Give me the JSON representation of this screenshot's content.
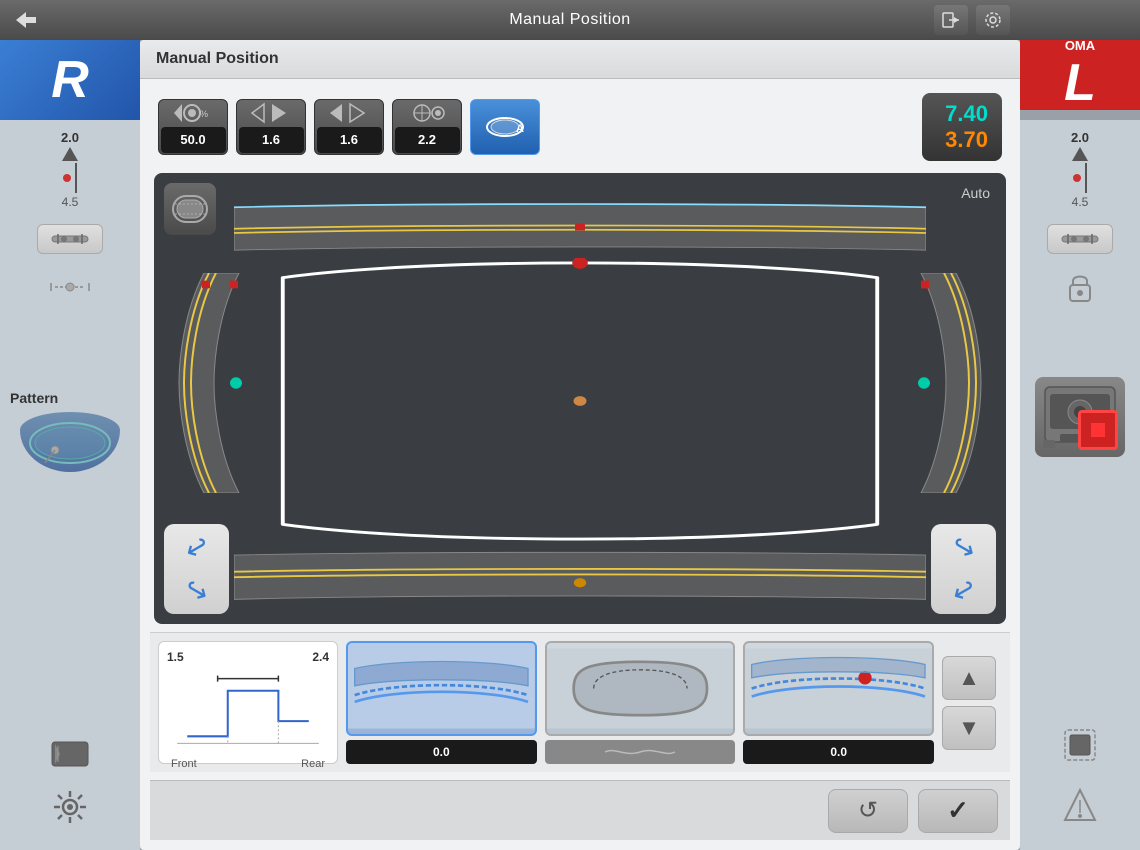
{
  "title": "Manual Position",
  "modal": {
    "title": "Manual Position"
  },
  "toolbar": {
    "tools": [
      {
        "id": "prism",
        "icon": "◁●",
        "value": "50.0",
        "suffix": "%",
        "active": false
      },
      {
        "id": "base1",
        "icon": "△▷",
        "value": "1.6",
        "active": false
      },
      {
        "id": "base2",
        "icon": "◁△",
        "value": "1.6",
        "active": false
      },
      {
        "id": "target",
        "icon": "⊕",
        "value": "2.2",
        "active": false
      },
      {
        "id": "lens",
        "icon": "◑",
        "value": "",
        "active": true
      }
    ],
    "val_cyan": "7.40",
    "val_orange": "3.70"
  },
  "viz": {
    "auto_label": "Auto"
  },
  "bottom_panel": {
    "profile": {
      "val_left": "1.5",
      "val_right": "2.4",
      "label_front": "Front",
      "label_rear": "Rear"
    },
    "options": [
      {
        "id": "opt1",
        "value": "0.0",
        "selected": true,
        "type": "curve"
      },
      {
        "id": "opt2",
        "value": "",
        "selected": false,
        "type": "profile"
      },
      {
        "id": "opt3",
        "value": "0.0",
        "selected": false,
        "type": "curve2"
      }
    ]
  },
  "actions": {
    "up_arrow": "▲",
    "down_arrow": "▼",
    "reset_icon": "↺",
    "confirm_icon": "✓"
  },
  "sidebar_left": {
    "value": "2.0",
    "sub": "4.5"
  },
  "sidebar_right": {
    "value": "2.0",
    "sub": "4.5"
  },
  "r_label": "R",
  "oma_label": "OMA",
  "l_label": "L",
  "pattern_label": "Pattern"
}
